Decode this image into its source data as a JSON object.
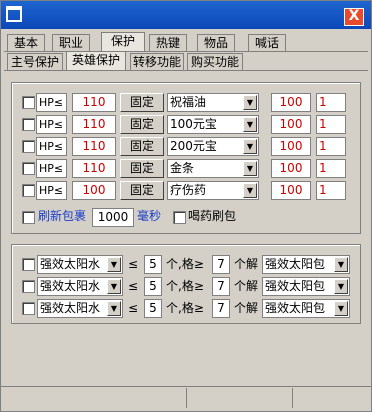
{
  "tabs": [
    "基本",
    "职业",
    "保护",
    "热键",
    "物品",
    "喊话"
  ],
  "subtabs": [
    "主号保护",
    "英雄保护",
    "转移功能",
    "购买功能"
  ],
  "close_label": "X",
  "hp_rows": [
    {
      "cond": "HP≤",
      "threshold": "110",
      "mode": "固定",
      "item": "祝福油",
      "count": "100",
      "num": "1"
    },
    {
      "cond": "HP≤",
      "threshold": "110",
      "mode": "固定",
      "item": "100元宝",
      "count": "100",
      "num": "1"
    },
    {
      "cond": "HP≤",
      "threshold": "110",
      "mode": "固定",
      "item": "200元宝",
      "count": "100",
      "num": "1"
    },
    {
      "cond": "HP≤",
      "threshold": "110",
      "mode": "固定",
      "item": "金条",
      "count": "100",
      "num": "1"
    },
    {
      "cond": "HP≤",
      "threshold": "100",
      "mode": "固定",
      "item": "疗伤药",
      "count": "100",
      "num": "1"
    }
  ],
  "refresh": {
    "label": "刷新包裹",
    "value": "1000",
    "unit": "毫秒",
    "drink_label": "喝药刷包"
  },
  "unpack_rows": [
    {
      "item": "强效太阳水",
      "op": "≤",
      "count": "5",
      "mid": "个,格≥",
      "slots": "7",
      "unpack": "个解",
      "pack": "强效太阳包"
    },
    {
      "item": "强效太阳水",
      "op": "≤",
      "count": "5",
      "mid": "个,格≥",
      "slots": "7",
      "unpack": "个解",
      "pack": "强效太阳包"
    },
    {
      "item": "强效太阳水",
      "op": "≤",
      "count": "5",
      "mid": "个,格≥",
      "slots": "7",
      "unpack": "个解",
      "pack": "强效太阳包"
    }
  ],
  "arrow_glyph": "▼"
}
